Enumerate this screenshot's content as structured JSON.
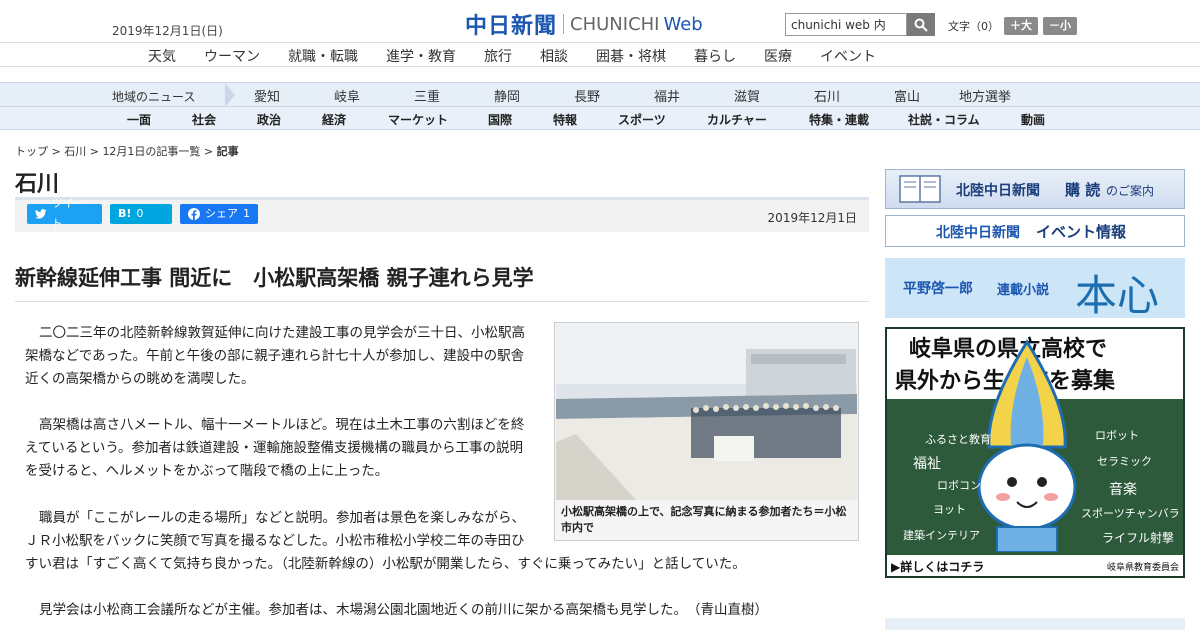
{
  "header": {
    "date": "2019年12月1日(日)",
    "logo_kanji": "中日新聞",
    "logo_en": "CHUNICHI",
    "logo_web": "Web",
    "search_value": "chunichi web 内",
    "fontsize_label": "文字（0）",
    "fontsize_up": "＋大",
    "fontsize_down": "－小"
  },
  "nav_main": [
    "天気",
    "ウーマン",
    "就職・転職",
    "進学・教育",
    "旅行",
    "相談",
    "囲碁・将棋",
    "暮らし",
    "医療",
    "イベント"
  ],
  "nav_region": {
    "label": "地域のニュース",
    "items": [
      "愛知",
      "岐阜",
      "三重",
      "静岡",
      "長野",
      "福井",
      "滋賀",
      "石川",
      "富山",
      "地方選挙"
    ]
  },
  "nav_sections": [
    "一面",
    "社会",
    "政治",
    "経済",
    "マーケット",
    "国際",
    "特報",
    "スポーツ",
    "カルチャー",
    "特集・連載",
    "社説・コラム",
    "動画"
  ],
  "breadcrumb": {
    "top": "トップ",
    "sep": " > ",
    "pref": "石川",
    "list": "12月1日の記事一覧",
    "current": "記事"
  },
  "section_title": "石川",
  "share": {
    "twitter": "ツイート",
    "hatena": "B!",
    "hatena_count": "0",
    "facebook": "シェア",
    "facebook_count": "1",
    "pubdate": "2019年12月1日"
  },
  "article": {
    "headline": "新幹線延伸工事 間近に　小松駅高架橋 親子連れら見学",
    "p1_l1": "二〇二三年の北陸新幹線敦賀延伸に向けた建設工事の見学会が三十日、小松駅高",
    "p1_l2": "架橋などであった。午前と午後の部に親子連れら計七十人が参加し、建設中の駅舎",
    "p1_l3": "近くの高架橋からの眺めを満喫した。",
    "p2_l1": "高架橋は高さ八メートル、幅十一メートルほど。現在は土木工事の六割ほどを終",
    "p2_l2": "えているという。参加者は鉄道建設・運輸施設整備支援機構の職員から工事の説明",
    "p2_l3": "を受けると、ヘルメットをかぶって階段で橋の上に上った。",
    "p3_l1": "職員が「ここがレールの走る場所」などと説明。参加者は景色を楽しみながら、",
    "p3_l2": "ＪＲ小松駅をバックに笑顔で写真を撮るなどした。小松市稚松小学校二年の寺田ひ",
    "p3_l3": "すい君は「すごく高くて気持ち良かった。（北陸新幹線の）小松駅が開業したら、すぐに乗ってみたい」と話していた。",
    "p4": "見学会は小松商工会議所などが主催。参加者は、木場潟公園北園地近くの前川に架かる高架橋も見学した。　（青山直樹）",
    "caption": "小松駅高架橋の上で、記念写真に納まる参加者たち＝小松市内で"
  },
  "sidebar": {
    "subscribe_a": "北陸中日新聞",
    "subscribe_b": "購 読",
    "subscribe_c": "のご案内",
    "events_a": "北陸中日新聞",
    "events_b": "イベント情報",
    "novel_author": "平野啓一郎",
    "novel_label": "連載小説",
    "novel_title": "本心",
    "ad_line1": "岐阜県の県立高校で",
    "ad_line2": "県外から生　徒を募集",
    "ad_topics": [
      "ふるさと教育",
      "ロボット",
      "福祉",
      "セラミック",
      "ロボコン",
      "音楽",
      "ヨット",
      "スポーツチャンバラ",
      "建築インテリア",
      "ライフル射撃"
    ],
    "ad_cta": "▶詳しくはコチラ",
    "ad_sponsor": "岐阜県教育委員会"
  },
  "colors": {
    "brand": "#1b56b0",
    "twitter": "#1da1f2",
    "hatena": "#00a4de",
    "facebook": "#1877f2",
    "chalkboard": "#2d5a3a"
  }
}
